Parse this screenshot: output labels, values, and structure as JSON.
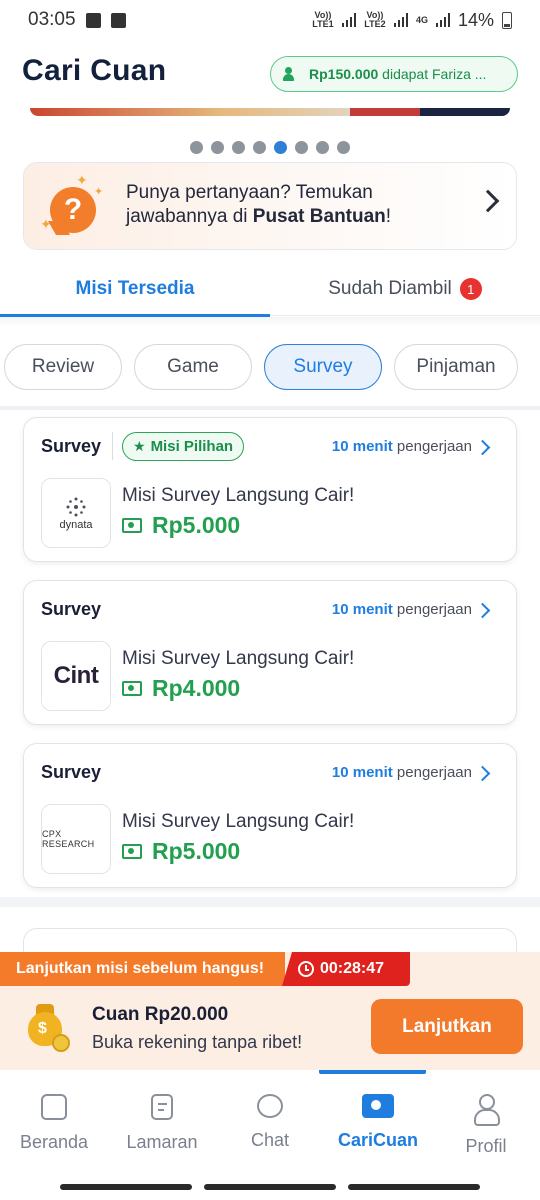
{
  "status_bar": {
    "time": "03:05",
    "sim1_label": "Vo)) LTE1",
    "sim2_label": "Vo)) LTE2",
    "network": "4G",
    "battery": "14%"
  },
  "header": {
    "title": "Cari Cuan",
    "reward_amount": "Rp150.000",
    "reward_text": "didapat Fariza ..."
  },
  "carousel": {
    "dot_count": 8,
    "active_index": 4
  },
  "help_card": {
    "text_line1": "Punya pertanyaan? Temukan",
    "text_line2_prefix": "jawabannya di ",
    "text_line2_bold": "Pusat Bantuan",
    "text_line2_suffix": "!"
  },
  "tabs": [
    {
      "label": "Misi Tersedia",
      "active": true
    },
    {
      "label": "Sudah Diambil",
      "badge": "1",
      "active": false
    }
  ],
  "chips": [
    {
      "label": "Review",
      "active": false
    },
    {
      "label": "Game",
      "active": false
    },
    {
      "label": "Survey",
      "active": true
    },
    {
      "label": "Pinjaman",
      "active": false
    }
  ],
  "missions": [
    {
      "category": "Survey",
      "pick_badge": "Misi Pilihan",
      "duration_bold": "10 menit",
      "duration_text": "pengerjaan",
      "logo": "dynata",
      "title": "Misi Survey Langsung Cair!",
      "price": "Rp5.000"
    },
    {
      "category": "Survey",
      "duration_bold": "10 menit",
      "duration_text": "pengerjaan",
      "logo": "Cint",
      "title": "Misi Survey Langsung Cair!",
      "price": "Rp4.000"
    },
    {
      "category": "Survey",
      "duration_bold": "10 menit",
      "duration_text": "pengerjaan",
      "logo": "CPX RESEARCH",
      "title": "Misi Survey Langsung Cair!",
      "price": "Rp5.000"
    }
  ],
  "continue_panel": {
    "warning": "Lanjutkan misi sebelum hangus!",
    "timer": "00:28:47",
    "title": "Cuan Rp20.000",
    "subtitle": "Buka rekening tanpa ribet!",
    "button": "Lanjutkan"
  },
  "bottom_nav": [
    {
      "label": "Beranda",
      "icon": "home-icon",
      "active": false
    },
    {
      "label": "Lamaran",
      "icon": "document-icon",
      "active": false
    },
    {
      "label": "Chat",
      "icon": "chat-icon",
      "active": false
    },
    {
      "label": "CariCuan",
      "icon": "money-icon",
      "active": true
    },
    {
      "label": "Profil",
      "icon": "profile-icon",
      "active": false
    }
  ],
  "colors": {
    "primary_blue": "#1f7de0",
    "green": "#22a04f",
    "orange": "#f37a2a",
    "red": "#e0221e"
  }
}
